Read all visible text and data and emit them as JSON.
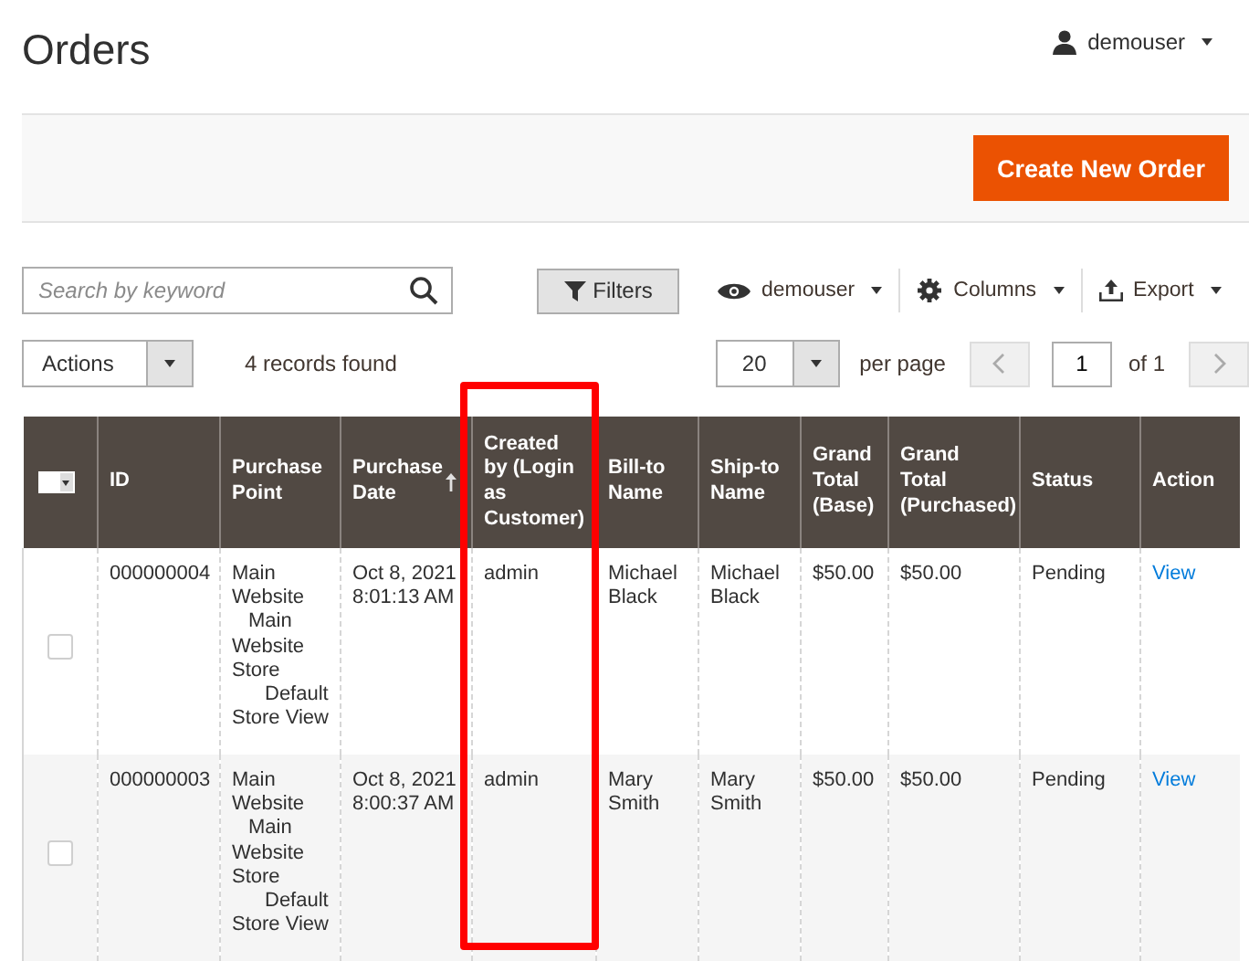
{
  "page_title": "Orders",
  "user_menu": {
    "label": "demouser"
  },
  "create_button": "Create New Order",
  "search": {
    "placeholder": "Search by keyword"
  },
  "filters_button": "Filters",
  "view_menu": "demouser",
  "columns_menu": "Columns",
  "export_menu": "Export",
  "actions_select": "Actions",
  "records_found": "4 records found",
  "per_page": {
    "value": "20",
    "label": "per page"
  },
  "pager": {
    "page": "1",
    "of": "of 1"
  },
  "table": {
    "columns": [
      {
        "label": "ID"
      },
      {
        "label": "Purchase Point"
      },
      {
        "label": "Purchase Date",
        "sorted": true
      },
      {
        "label": "Created by (Login as Customer)",
        "highlighted": true
      },
      {
        "label": "Bill-to Name"
      },
      {
        "label": "Ship-to Name"
      },
      {
        "label": "Grand Total (Base)"
      },
      {
        "label": "Grand Total (Purchased)"
      },
      {
        "label": "Status"
      },
      {
        "label": "Action"
      }
    ],
    "rows": [
      {
        "checked": false,
        "id": "000000004",
        "purchase_point": {
          "label": "Main Website",
          "children": [
            {
              "label": "Main Website Store",
              "children": [
                {
                  "label": "Default Store View"
                }
              ]
            }
          ]
        },
        "date": "Oct 8, 2021 8:01:13 AM",
        "created_by": "admin",
        "bill_to": "Michael Black",
        "ship_to": "Michael Black",
        "total_base": "$50.00",
        "total_purchased": "$50.00",
        "status": "Pending",
        "action": "View"
      },
      {
        "checked": false,
        "id": "000000003",
        "purchase_point": {
          "label": "Main Website",
          "children": [
            {
              "label": "Main Website Store",
              "children": [
                {
                  "label": "Default Store View"
                }
              ]
            }
          ]
        },
        "date": "Oct 8, 2021 8:00:37 AM",
        "created_by": "admin",
        "bill_to": "Mary Smith",
        "ship_to": "Mary Smith",
        "total_base": "$50.00",
        "total_purchased": "$50.00",
        "status": "Pending",
        "action": "View"
      }
    ]
  }
}
